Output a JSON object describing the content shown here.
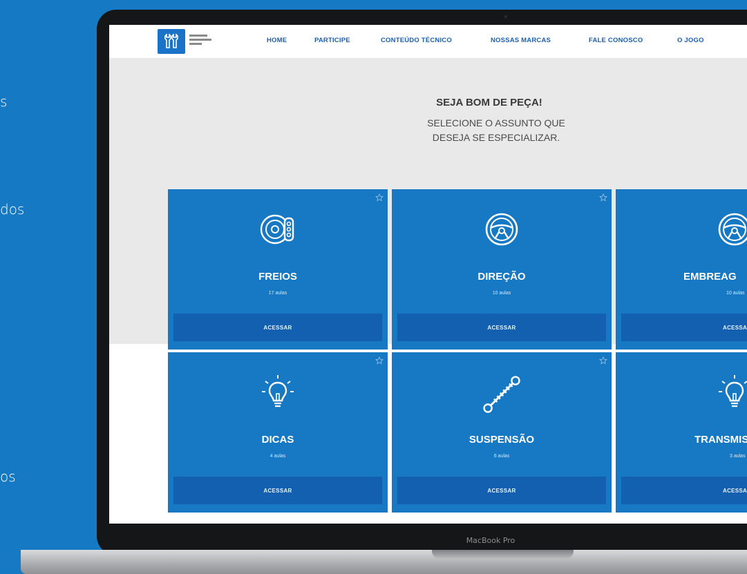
{
  "side_text": [
    "s",
    "dos",
    "os"
  ],
  "nav": {
    "items": [
      "HOME",
      "PARTICIPE",
      "CONTEÚDO TÉCNICO",
      "NOSSAS MARCAS",
      "FALE CONOSCO",
      "O JOGO"
    ]
  },
  "hero": {
    "title": "SEJA BOM DE PEÇA!",
    "subtitle_line1": "SELECIONE O ASSUNTO QUE",
    "subtitle_line2": "DESEJA SE ESPECIALIZAR."
  },
  "cards": [
    {
      "title": "FREIOS",
      "count": "17 aulas",
      "button": "ACESSAR",
      "icon": "brake-disc-icon"
    },
    {
      "title": "DIREÇÃO",
      "count": "10 aulas",
      "button": "ACESSAR",
      "icon": "steering-wheel-icon"
    },
    {
      "title": "EMBREAG",
      "count": "10 aulas",
      "button": "ACESSAR",
      "icon": "steering-wheel-icon"
    },
    {
      "title": "DICAS",
      "count": "4 aulas",
      "button": "ACESSAR",
      "icon": "lightbulb-icon"
    },
    {
      "title": "SUSPENSÃO",
      "count": "6 aulas",
      "button": "ACESSAR",
      "icon": "shock-absorber-icon"
    },
    {
      "title": "TRANSMIS",
      "count": "3 aulas",
      "button": "ACESSAR",
      "icon": "lightbulb-icon"
    }
  ],
  "laptop_model": "MacBook Pro",
  "colors": {
    "background": "#1679c3",
    "card": "#1779c4",
    "button": "#1460b0",
    "nav_text": "#1a5fb4"
  }
}
